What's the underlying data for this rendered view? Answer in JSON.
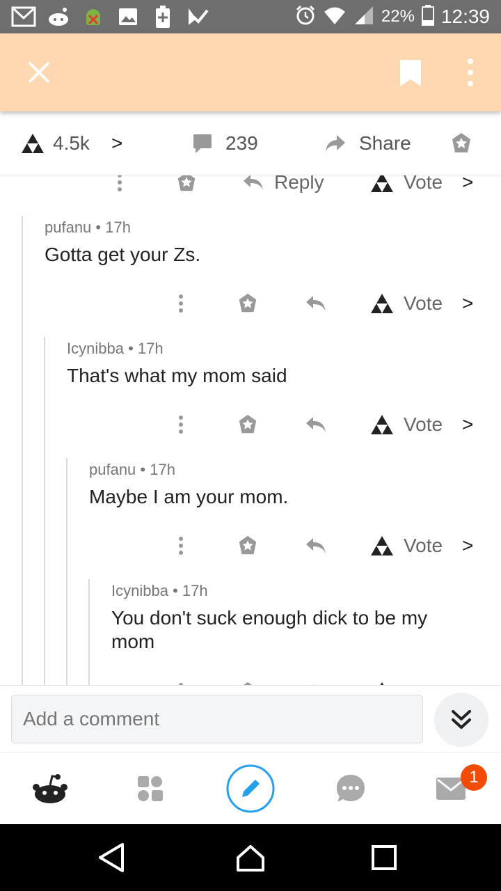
{
  "status_bar": {
    "battery": "22%",
    "time": "12:39",
    "left_icons": [
      "gmail-icon",
      "reddit-icon",
      "android-debug-icon",
      "image-icon",
      "battery-saver-icon",
      "tasks-check-icon"
    ],
    "right_icons": [
      "alarm-icon",
      "wifi-icon",
      "signal-icon",
      "battery-icon"
    ]
  },
  "app_bar": {
    "bg": "#fed8b0",
    "icons": [
      "close-icon",
      "bookmark-icon",
      "more-vertical-icon"
    ]
  },
  "post_actions": {
    "score": "4.5k",
    "downvote_glyph": ">",
    "comments": "239",
    "share": "Share"
  },
  "top_actions": {
    "reply": "Reply",
    "vote": "Vote",
    "arrow": ">"
  },
  "comments": [
    {
      "author": "pufanu",
      "age": "17h",
      "body": "Gotta get your Zs.",
      "vote": "Vote",
      "arrow": ">"
    },
    {
      "author": "Icynibba",
      "age": "17h",
      "body": "That's what my mom said",
      "vote": "Vote",
      "arrow": ">"
    },
    {
      "author": "pufanu",
      "age": "17h",
      "body": "Maybe I am your mom.",
      "vote": "Vote",
      "arrow": ">"
    },
    {
      "author": "Icynibba",
      "age": "17h",
      "body": "You don't suck enough dick to be my mom"
    }
  ],
  "meta_separator": "•",
  "composer": {
    "placeholder": "Add a comment"
  },
  "bottom_nav": {
    "inbox_badge": "1",
    "accent": "#24a0ed"
  }
}
